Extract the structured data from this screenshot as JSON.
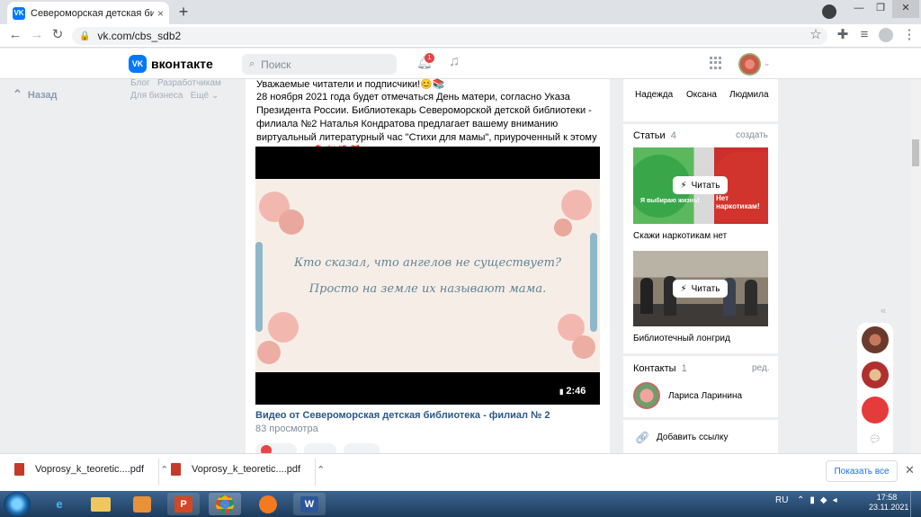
{
  "browser": {
    "tab_title": "Североморская детская библио",
    "tab_close": "×",
    "new_tab": "+",
    "url": "vk.com/cbs_sdb2",
    "window_min": "—",
    "window_max": "❐",
    "window_close": "✕"
  },
  "vk": {
    "logo_text": "вконтакте",
    "logo_mark": "VK",
    "search_placeholder": "Поиск",
    "notification_count": "1"
  },
  "left_nav": {
    "back_label": "Назад",
    "links": [
      "Блог",
      "Разработчикам",
      "Для бизнеса",
      "Ещё"
    ]
  },
  "post": {
    "text_line1": "Уважаемые читатели и подписчики!😊📚",
    "text_body": "28 ноября 2021 года будет отмечаться День матери, согласно Указа Президента России. Библиотекарь Североморской детской библиотеки - филиала №2 Наталья Кондратова предлагает вашему вниманию виртуальный литературный час \"Стихи для мамы\", приуроченный к этому событию.✨🎈🎉🌺🎁",
    "video": {
      "line1": "Кто сказал, что ангелов не существует?",
      "line2": "Просто на земле их называют мама.",
      "duration": "2:46",
      "title": "Видео от Североморская детская библиотека - филиал № 2",
      "views": "83 просмотра"
    }
  },
  "friends": [
    "Надежда",
    "Оксана",
    "Людмила"
  ],
  "articles": {
    "label": "Статьи",
    "count": "4",
    "create": "создать",
    "read_label": "Читать",
    "items": [
      {
        "caption": "Скажи наркотикам нет",
        "img_text_left": "Я выбираю жизнь!",
        "img_text_right": "Нет наркотикам!"
      },
      {
        "caption": "Библиотечный лонгрид"
      }
    ]
  },
  "contacts": {
    "label": "Контакты",
    "count": "1",
    "edit": "ред.",
    "items": [
      {
        "name": "Лариса Ларинина"
      }
    ]
  },
  "add_link": "Добавить ссылку",
  "downloads": {
    "items": [
      "Voprosy_k_teoretic....pdf",
      "Voprosy_k_teoretic....pdf"
    ],
    "show_all": "Показать все"
  },
  "taskbar": {
    "lang": "RU",
    "time": "17:58",
    "date": "23.11.2021"
  },
  "colors": {
    "vk_blue": "#0077ff",
    "link_blue": "#2a5885",
    "badge_red": "#e64646"
  }
}
